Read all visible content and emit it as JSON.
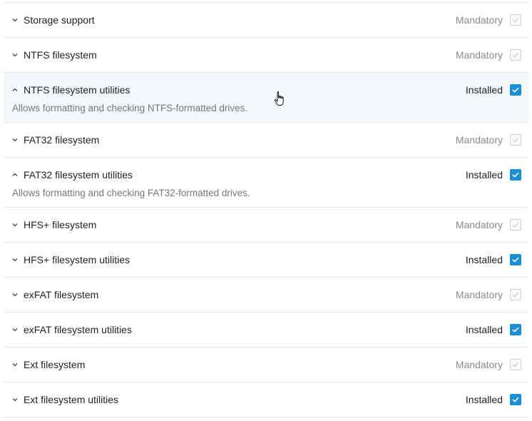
{
  "items": [
    {
      "label": "Storage support",
      "status": "Mandatory",
      "expanded": false,
      "description": ""
    },
    {
      "label": "NTFS filesystem",
      "status": "Mandatory",
      "expanded": false,
      "description": ""
    },
    {
      "label": "NTFS filesystem utilities",
      "status": "Installed",
      "expanded": true,
      "description": "Allows formatting and checking NTFS-formatted drives."
    },
    {
      "label": "FAT32 filesystem",
      "status": "Mandatory",
      "expanded": false,
      "description": ""
    },
    {
      "label": "FAT32 filesystem utilities",
      "status": "Installed",
      "expanded": true,
      "description": "Allows formatting and checking FAT32-formatted drives."
    },
    {
      "label": "HFS+ filesystem",
      "status": "Mandatory",
      "expanded": false,
      "description": ""
    },
    {
      "label": "HFS+ filesystem utilities",
      "status": "Installed",
      "expanded": false,
      "description": ""
    },
    {
      "label": "exFAT filesystem",
      "status": "Mandatory",
      "expanded": false,
      "description": ""
    },
    {
      "label": "exFAT filesystem utilities",
      "status": "Installed",
      "expanded": false,
      "description": ""
    },
    {
      "label": "Ext filesystem",
      "status": "Mandatory",
      "expanded": false,
      "description": ""
    },
    {
      "label": "Ext filesystem utilities",
      "status": "Installed",
      "expanded": false,
      "description": ""
    }
  ],
  "colors": {
    "accent": "#1a8fd6",
    "hover_row": "#f3f8fb",
    "mandatory_text": "#8a8a8a"
  },
  "icons": {
    "expand": "chevron-down-icon",
    "collapse": "chevron-up-icon",
    "cursor": "hand-pointer-icon"
  }
}
